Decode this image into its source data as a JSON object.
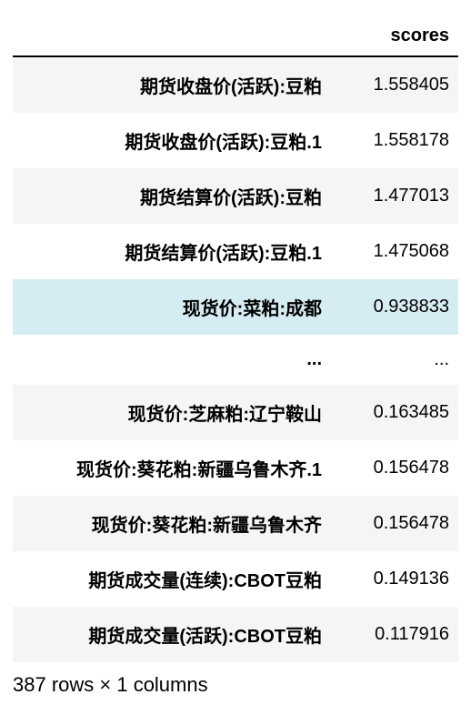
{
  "table": {
    "column_header": "scores",
    "rows": [
      {
        "label": "期货收盘价(活跃):豆粕",
        "value": "1.558405",
        "highlight": false
      },
      {
        "label": "期货收盘价(活跃):豆粕.1",
        "value": "1.558178",
        "highlight": false
      },
      {
        "label": "期货结算价(活跃):豆粕",
        "value": "1.477013",
        "highlight": false
      },
      {
        "label": "期货结算价(活跃):豆粕.1",
        "value": "1.475068",
        "highlight": false
      },
      {
        "label": "现货价:菜粕:成都",
        "value": "0.938833",
        "highlight": true
      },
      {
        "label": "...",
        "value": "...",
        "highlight": false
      },
      {
        "label": "现货价:芝麻粕:辽宁鞍山",
        "value": "0.163485",
        "highlight": false
      },
      {
        "label": "现货价:葵花粕:新疆乌鲁木齐.1",
        "value": "0.156478",
        "highlight": false
      },
      {
        "label": "现货价:葵花粕:新疆乌鲁木齐",
        "value": "0.156478",
        "highlight": false
      },
      {
        "label": "期货成交量(连续):CBOT豆粕",
        "value": "0.149136",
        "highlight": false
      },
      {
        "label": "期货成交量(活跃):CBOT豆粕",
        "value": "0.117916",
        "highlight": false
      }
    ],
    "summary": "387 rows × 1 columns"
  }
}
